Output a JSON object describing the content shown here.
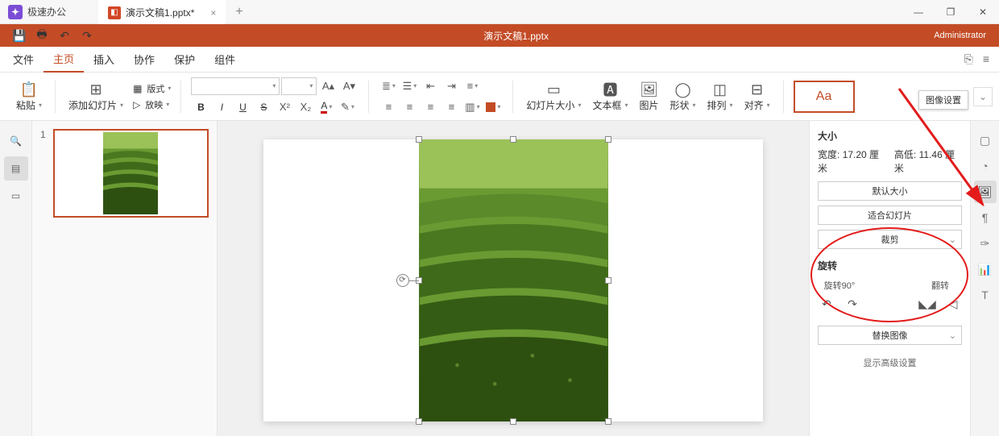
{
  "app": {
    "name": "极速办公"
  },
  "tab": {
    "title": "演示文稿1.pptx*"
  },
  "window": {
    "title": "演示文稿1.pptx"
  },
  "user": {
    "name": "Administrator"
  },
  "menu": {
    "file": "文件",
    "home": "主页",
    "insert": "插入",
    "collab": "协作",
    "protect": "保护",
    "plugin": "组件"
  },
  "ribbon": {
    "paste": "粘贴",
    "addSlide": "添加幻灯片",
    "layout": "版式",
    "play": "放映",
    "slideSize": "幻灯片大小",
    "textbox": "文本框",
    "picture": "图片",
    "shape": "形状",
    "arrange": "排列",
    "align": "对齐",
    "theme": "Aa"
  },
  "thumb": {
    "num": "1"
  },
  "panel": {
    "sizeTitle": "大小",
    "widthLabel": "宽度:",
    "widthVal": "17.20 厘米",
    "heightLabel": "高低:",
    "heightVal": "11.46 厘米",
    "defaultSize": "默认大小",
    "fitSlide": "适合幻灯片",
    "crop": "裁剪",
    "rotateTitle": "旋转",
    "rotate90": "旋转90°",
    "flip": "翻转",
    "replaceImage": "替换图像",
    "advanced": "显示高级设置"
  },
  "tooltip": {
    "imageSettings": "图像设置"
  }
}
